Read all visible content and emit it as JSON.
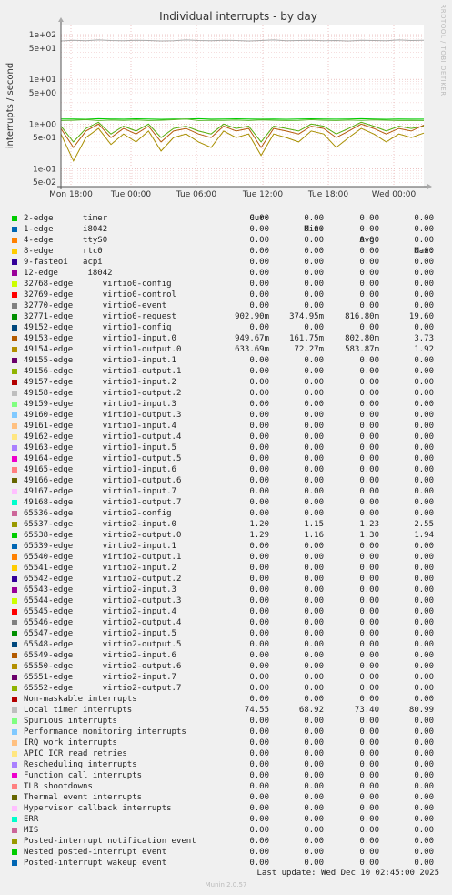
{
  "chart_data": {
    "type": "line",
    "title": "Individual interrupts - by day",
    "ylabel": "interrupts / second",
    "side_label": "RRDTOOL / TOBI OETIKER",
    "scale": "log",
    "ylim": [
      0.04,
      160
    ],
    "y_ticks": [
      {
        "v": 0.05,
        "label": "5e-02"
      },
      {
        "v": 0.1,
        "label": "1e-01"
      },
      {
        "v": 0.5,
        "label": "5e-01"
      },
      {
        "v": 1,
        "label": "1e+00"
      },
      {
        "v": 5,
        "label": "5e+00"
      },
      {
        "v": 10,
        "label": "1e+01"
      },
      {
        "v": 50,
        "label": "5e+01"
      },
      {
        "v": 100,
        "label": "1e+02"
      }
    ],
    "x_ticks": [
      "Mon 18:00",
      "Tue 00:00",
      "Tue 06:00",
      "Tue 12:00",
      "Tue 18:00",
      "Wed 00:00"
    ],
    "grid": true,
    "series": [
      {
        "name": "Local timer interrupts",
        "color": "#aaaaaa",
        "values": [
          72,
          75,
          73,
          76,
          74,
          73,
          75,
          74,
          72,
          73,
          76,
          74,
          73,
          75,
          74,
          72,
          74,
          76,
          73,
          74,
          75,
          73,
          74,
          72,
          75,
          74,
          73,
          76,
          74,
          75
        ]
      },
      {
        "name": "65538-edge virtio2-output.0",
        "color": "#00cc00",
        "values": [
          1.3,
          1.3,
          1.28,
          1.32,
          1.3,
          1.29,
          1.31,
          1.3,
          1.28,
          1.3,
          1.3,
          1.32,
          1.29,
          1.3,
          1.31,
          1.3,
          1.29,
          1.3,
          1.28,
          1.3,
          1.31,
          1.3,
          1.29,
          1.3,
          1.32,
          1.3,
          1.28,
          1.3,
          1.29,
          1.29
        ]
      },
      {
        "name": "65537-edge virtio2-input.0",
        "color": "#57b327",
        "values": [
          1.2,
          1.22,
          1.25,
          1.2,
          1.23,
          1.21,
          1.24,
          1.2,
          1.22,
          1.25,
          1.3,
          1.2,
          1.22,
          1.21,
          1.23,
          1.2,
          1.24,
          1.22,
          1.2,
          1.21,
          1.25,
          1.22,
          1.2,
          1.23,
          1.21,
          1.24,
          1.22,
          1.2,
          1.21,
          1.2
        ]
      },
      {
        "name": "32771-edge virtio0-request",
        "color": "#55ad0a",
        "values": [
          0.9,
          0.4,
          0.8,
          1.1,
          0.6,
          0.9,
          0.7,
          1.0,
          0.5,
          0.8,
          0.9,
          0.7,
          0.6,
          1.0,
          0.8,
          0.9,
          0.4,
          0.9,
          0.8,
          0.7,
          1.0,
          0.9,
          0.6,
          0.8,
          1.1,
          0.9,
          0.7,
          0.9,
          0.8,
          0.9
        ]
      },
      {
        "name": "49153-edge virtio1-input.0",
        "color": "#b35a0a",
        "values": [
          0.8,
          0.3,
          0.7,
          1.0,
          0.5,
          0.8,
          0.6,
          0.9,
          0.4,
          0.7,
          0.8,
          0.6,
          0.5,
          0.9,
          0.7,
          0.8,
          0.3,
          0.8,
          0.7,
          0.6,
          0.9,
          0.8,
          0.5,
          0.7,
          1.0,
          0.8,
          0.6,
          0.8,
          0.7,
          0.95
        ]
      },
      {
        "name": "49154-edge virtio1-output.0",
        "color": "#a88f00",
        "values": [
          0.6,
          0.15,
          0.5,
          0.8,
          0.35,
          0.6,
          0.4,
          0.7,
          0.25,
          0.5,
          0.6,
          0.4,
          0.3,
          0.7,
          0.5,
          0.6,
          0.2,
          0.6,
          0.5,
          0.4,
          0.7,
          0.6,
          0.3,
          0.5,
          0.8,
          0.6,
          0.4,
          0.6,
          0.5,
          0.63
        ]
      }
    ]
  },
  "legend": {
    "headers": {
      "cur": "Cur:",
      "min": "Min:",
      "avg": "Avg:",
      "max": "Max:"
    },
    "rows": [
      {
        "name": "2-edge      timer",
        "color": "#00cc00",
        "cur": "0.00",
        "min": "0.00",
        "avg": "0.00",
        "max": "0.00"
      },
      {
        "name": "1-edge      i8042",
        "color": "#0066b3",
        "cur": "0.00",
        "min": "0.00",
        "avg": "0.00",
        "max": "0.00"
      },
      {
        "name": "4-edge      ttyS0",
        "color": "#ff8000",
        "cur": "0.00",
        "min": "0.00",
        "avg": "0.00",
        "max": "0.00"
      },
      {
        "name": "8-edge      rtc0",
        "color": "#ffcc00",
        "cur": "0.00",
        "min": "0.00",
        "avg": "0.00",
        "max": "0.00"
      },
      {
        "name": "9-fasteoi   acpi",
        "color": "#330099",
        "cur": "0.00",
        "min": "0.00",
        "avg": "0.00",
        "max": "0.00"
      },
      {
        "name": "12-edge      i8042",
        "color": "#990099",
        "cur": "0.00",
        "min": "0.00",
        "avg": "0.00",
        "max": "0.00"
      },
      {
        "name": "32768-edge      virtio0-config",
        "color": "#ccff00",
        "cur": "0.00",
        "min": "0.00",
        "avg": "0.00",
        "max": "0.00"
      },
      {
        "name": "32769-edge      virtio0-control",
        "color": "#ff0000",
        "cur": "0.00",
        "min": "0.00",
        "avg": "0.00",
        "max": "0.00"
      },
      {
        "name": "32770-edge      virtio0-event",
        "color": "#808080",
        "cur": "0.00",
        "min": "0.00",
        "avg": "0.00",
        "max": "0.00"
      },
      {
        "name": "32771-edge      virtio0-request",
        "color": "#008f00",
        "cur": "902.90m",
        "min": "374.95m",
        "avg": "816.80m",
        "max": "19.60"
      },
      {
        "name": "49152-edge      virtio1-config",
        "color": "#00487d",
        "cur": "0.00",
        "min": "0.00",
        "avg": "0.00",
        "max": "0.00"
      },
      {
        "name": "49153-edge      virtio1-input.0",
        "color": "#b35a00",
        "cur": "949.67m",
        "min": "161.75m",
        "avg": "802.80m",
        "max": "3.73"
      },
      {
        "name": "49154-edge      virtio1-output.0",
        "color": "#b38f00",
        "cur": "633.69m",
        "min": "72.27m",
        "avg": "583.87m",
        "max": "1.92"
      },
      {
        "name": "49155-edge      virtio1-input.1",
        "color": "#6b006b",
        "cur": "0.00",
        "min": "0.00",
        "avg": "0.00",
        "max": "0.00"
      },
      {
        "name": "49156-edge      virtio1-output.1",
        "color": "#8fb300",
        "cur": "0.00",
        "min": "0.00",
        "avg": "0.00",
        "max": "0.00"
      },
      {
        "name": "49157-edge      virtio1-input.2",
        "color": "#b30000",
        "cur": "0.00",
        "min": "0.00",
        "avg": "0.00",
        "max": "0.00"
      },
      {
        "name": "49158-edge      virtio1-output.2",
        "color": "#bebebe",
        "cur": "0.00",
        "min": "0.00",
        "avg": "0.00",
        "max": "0.00"
      },
      {
        "name": "49159-edge      virtio1-input.3",
        "color": "#80ff80",
        "cur": "0.00",
        "min": "0.00",
        "avg": "0.00",
        "max": "0.00"
      },
      {
        "name": "49160-edge      virtio1-output.3",
        "color": "#80c9ff",
        "cur": "0.00",
        "min": "0.00",
        "avg": "0.00",
        "max": "0.00"
      },
      {
        "name": "49161-edge      virtio1-input.4",
        "color": "#ffc080",
        "cur": "0.00",
        "min": "0.00",
        "avg": "0.00",
        "max": "0.00"
      },
      {
        "name": "49162-edge      virtio1-output.4",
        "color": "#ffe680",
        "cur": "0.00",
        "min": "0.00",
        "avg": "0.00",
        "max": "0.00"
      },
      {
        "name": "49163-edge      virtio1-input.5",
        "color": "#aa80ff",
        "cur": "0.00",
        "min": "0.00",
        "avg": "0.00",
        "max": "0.00"
      },
      {
        "name": "49164-edge      virtio1-output.5",
        "color": "#ee00cc",
        "cur": "0.00",
        "min": "0.00",
        "avg": "0.00",
        "max": "0.00"
      },
      {
        "name": "49165-edge      virtio1-input.6",
        "color": "#ff8080",
        "cur": "0.00",
        "min": "0.00",
        "avg": "0.00",
        "max": "0.00"
      },
      {
        "name": "49166-edge      virtio1-output.6",
        "color": "#666600",
        "cur": "0.00",
        "min": "0.00",
        "avg": "0.00",
        "max": "0.00"
      },
      {
        "name": "49167-edge      virtio1-input.7",
        "color": "#ffbfff",
        "cur": "0.00",
        "min": "0.00",
        "avg": "0.00",
        "max": "0.00"
      },
      {
        "name": "49168-edge      virtio1-output.7",
        "color": "#00ffcc",
        "cur": "0.00",
        "min": "0.00",
        "avg": "0.00",
        "max": "0.00"
      },
      {
        "name": "65536-edge      virtio2-config",
        "color": "#cc6699",
        "cur": "0.00",
        "min": "0.00",
        "avg": "0.00",
        "max": "0.00"
      },
      {
        "name": "65537-edge      virtio2-input.0",
        "color": "#999900",
        "cur": "1.20",
        "min": "1.15",
        "avg": "1.23",
        "max": "2.55"
      },
      {
        "name": "65538-edge      virtio2-output.0",
        "color": "#00cc00",
        "cur": "1.29",
        "min": "1.16",
        "avg": "1.30",
        "max": "1.94"
      },
      {
        "name": "65539-edge      virtio2-input.1",
        "color": "#0066b3",
        "cur": "0.00",
        "min": "0.00",
        "avg": "0.00",
        "max": "0.00"
      },
      {
        "name": "65540-edge      virtio2-output.1",
        "color": "#ff8000",
        "cur": "0.00",
        "min": "0.00",
        "avg": "0.00",
        "max": "0.00"
      },
      {
        "name": "65541-edge      virtio2-input.2",
        "color": "#ffcc00",
        "cur": "0.00",
        "min": "0.00",
        "avg": "0.00",
        "max": "0.00"
      },
      {
        "name": "65542-edge      virtio2-output.2",
        "color": "#330099",
        "cur": "0.00",
        "min": "0.00",
        "avg": "0.00",
        "max": "0.00"
      },
      {
        "name": "65543-edge      virtio2-input.3",
        "color": "#990099",
        "cur": "0.00",
        "min": "0.00",
        "avg": "0.00",
        "max": "0.00"
      },
      {
        "name": "65544-edge      virtio2-output.3",
        "color": "#ccff00",
        "cur": "0.00",
        "min": "0.00",
        "avg": "0.00",
        "max": "0.00"
      },
      {
        "name": "65545-edge      virtio2-input.4",
        "color": "#ff0000",
        "cur": "0.00",
        "min": "0.00",
        "avg": "0.00",
        "max": "0.00"
      },
      {
        "name": "65546-edge      virtio2-output.4",
        "color": "#808080",
        "cur": "0.00",
        "min": "0.00",
        "avg": "0.00",
        "max": "0.00"
      },
      {
        "name": "65547-edge      virtio2-input.5",
        "color": "#008f00",
        "cur": "0.00",
        "min": "0.00",
        "avg": "0.00",
        "max": "0.00"
      },
      {
        "name": "65548-edge      virtio2-output.5",
        "color": "#00487d",
        "cur": "0.00",
        "min": "0.00",
        "avg": "0.00",
        "max": "0.00"
      },
      {
        "name": "65549-edge      virtio2-input.6",
        "color": "#b35a00",
        "cur": "0.00",
        "min": "0.00",
        "avg": "0.00",
        "max": "0.00"
      },
      {
        "name": "65550-edge      virtio2-output.6",
        "color": "#b38f00",
        "cur": "0.00",
        "min": "0.00",
        "avg": "0.00",
        "max": "0.00"
      },
      {
        "name": "65551-edge      virtio2-input.7",
        "color": "#6b006b",
        "cur": "0.00",
        "min": "0.00",
        "avg": "0.00",
        "max": "0.00"
      },
      {
        "name": "65552-edge      virtio2-output.7",
        "color": "#8fb300",
        "cur": "0.00",
        "min": "0.00",
        "avg": "0.00",
        "max": "0.00"
      },
      {
        "name": "Non-maskable interrupts",
        "color": "#b30000",
        "cur": "0.00",
        "min": "0.00",
        "avg": "0.00",
        "max": "0.00"
      },
      {
        "name": "Local timer interrupts",
        "color": "#bebebe",
        "cur": "74.55",
        "min": "68.92",
        "avg": "73.40",
        "max": "80.99"
      },
      {
        "name": "Spurious interrupts",
        "color": "#80ff80",
        "cur": "0.00",
        "min": "0.00",
        "avg": "0.00",
        "max": "0.00"
      },
      {
        "name": "Performance monitoring interrupts",
        "color": "#80c9ff",
        "cur": "0.00",
        "min": "0.00",
        "avg": "0.00",
        "max": "0.00"
      },
      {
        "name": "IRQ work interrupts",
        "color": "#ffc080",
        "cur": "0.00",
        "min": "0.00",
        "avg": "0.00",
        "max": "0.00"
      },
      {
        "name": "APIC ICR read retries",
        "color": "#ffe680",
        "cur": "0.00",
        "min": "0.00",
        "avg": "0.00",
        "max": "0.00"
      },
      {
        "name": "Rescheduling interrupts",
        "color": "#aa80ff",
        "cur": "0.00",
        "min": "0.00",
        "avg": "0.00",
        "max": "0.00"
      },
      {
        "name": "Function call interrupts",
        "color": "#ee00cc",
        "cur": "0.00",
        "min": "0.00",
        "avg": "0.00",
        "max": "0.00"
      },
      {
        "name": "TLB shootdowns",
        "color": "#ff8080",
        "cur": "0.00",
        "min": "0.00",
        "avg": "0.00",
        "max": "0.00"
      },
      {
        "name": "Thermal event interrupts",
        "color": "#666600",
        "cur": "0.00",
        "min": "0.00",
        "avg": "0.00",
        "max": "0.00"
      },
      {
        "name": "Hypervisor callback interrupts",
        "color": "#ffbfff",
        "cur": "0.00",
        "min": "0.00",
        "avg": "0.00",
        "max": "0.00"
      },
      {
        "name": "ERR",
        "color": "#00ffcc",
        "cur": "0.00",
        "min": "0.00",
        "avg": "0.00",
        "max": "0.00"
      },
      {
        "name": "MIS",
        "color": "#cc6699",
        "cur": "0.00",
        "min": "0.00",
        "avg": "0.00",
        "max": "0.00"
      },
      {
        "name": "Posted-interrupt notification event",
        "color": "#999900",
        "cur": "0.00",
        "min": "0.00",
        "avg": "0.00",
        "max": "0.00"
      },
      {
        "name": "Nested posted-interrupt event",
        "color": "#00cc00",
        "cur": "0.00",
        "min": "0.00",
        "avg": "0.00",
        "max": "0.00"
      },
      {
        "name": "Posted-interrupt wakeup event",
        "color": "#0066b3",
        "cur": "0.00",
        "min": "0.00",
        "avg": "0.00",
        "max": "0.00"
      }
    ]
  },
  "footer": {
    "last_update": "Last update: Wed Dec 10 02:45:00 2025",
    "version": "Munin 2.0.57"
  }
}
